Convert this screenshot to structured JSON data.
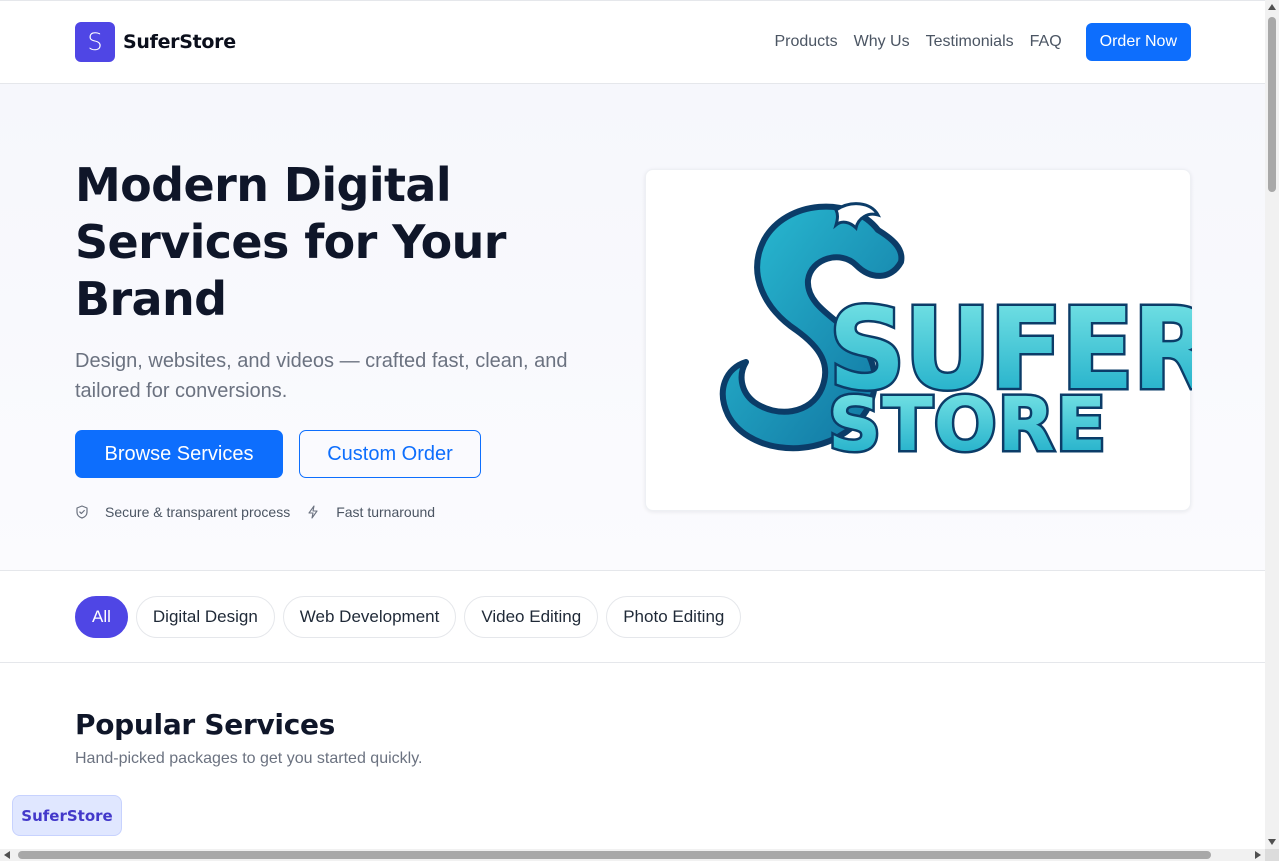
{
  "brand": {
    "mark": "S",
    "name": "SuferStore"
  },
  "nav": {
    "links": [
      "Products",
      "Why Us",
      "Testimonials",
      "FAQ"
    ],
    "cta": "Order Now"
  },
  "hero": {
    "title": "Modern Digital Services for Your Brand",
    "subtitle": "Design, websites, and videos — crafted fast, clean, and tailored for conversions.",
    "primary_button": "Browse Services",
    "secondary_button": "Custom Order",
    "notes": [
      {
        "icon": "shield-icon",
        "text": "Secure & transparent process"
      },
      {
        "icon": "lightning-icon",
        "text": "Fast turnaround"
      }
    ],
    "logo": {
      "line1": "SUFER",
      "line2": "STORE"
    }
  },
  "filters": {
    "chips": [
      "All",
      "Digital Design",
      "Web Development",
      "Video Editing",
      "Photo Editing"
    ],
    "active": "All"
  },
  "popular": {
    "title": "Popular Services",
    "subtitle": "Hand-picked packages to get you started quickly."
  },
  "floating_badge": "SuferStore",
  "colors": {
    "primary": "#0d6efd",
    "accent": "#4f46e5",
    "logo_teal": "#1ea7c4",
    "logo_navy": "#0b3c68"
  }
}
